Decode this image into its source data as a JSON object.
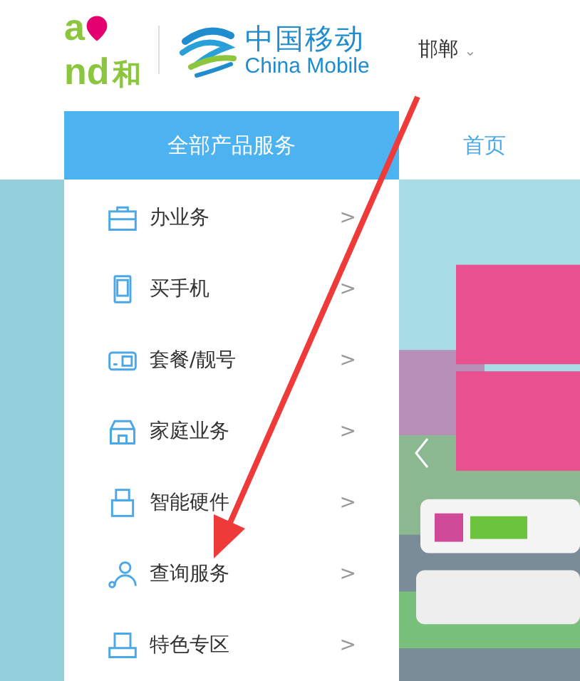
{
  "brand": {
    "top": "a",
    "bottom": "nd",
    "char": "和"
  },
  "logo": {
    "title": "中国移动",
    "subtitle": "China Mobile"
  },
  "city": {
    "label": "邯郸",
    "caret": "⌄"
  },
  "nav": [
    {
      "label": "全部产品服务",
      "selected": true
    },
    {
      "label": "首页",
      "selected": false
    }
  ],
  "menu": [
    {
      "kind": "briefcase",
      "label": "办业务",
      "chevron": ">"
    },
    {
      "kind": "phone",
      "label": "买手机",
      "chevron": ">"
    },
    {
      "kind": "card",
      "label": "套餐/靓号",
      "chevron": ">"
    },
    {
      "kind": "house",
      "label": "家庭业务",
      "chevron": ">"
    },
    {
      "kind": "usb",
      "label": "智能硬件",
      "chevron": ">"
    },
    {
      "kind": "person",
      "label": "查询服务",
      "chevron": ">"
    },
    {
      "kind": "hat",
      "label": "特色专区",
      "chevron": ">"
    }
  ]
}
